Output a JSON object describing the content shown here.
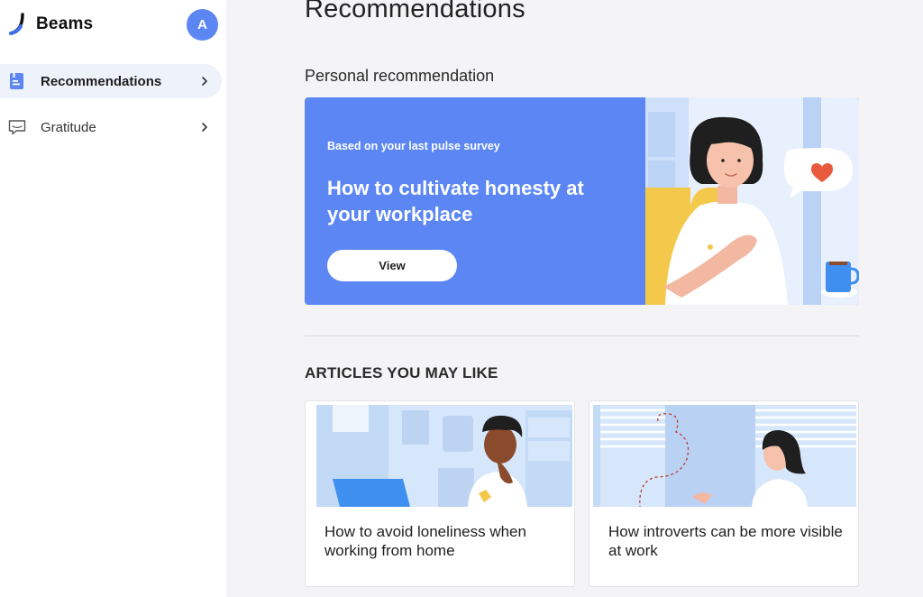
{
  "app": {
    "name": "Beams",
    "avatar_initial": "A",
    "accent": "#5b86f4"
  },
  "sidebar": {
    "items": [
      {
        "label": "Recommendations",
        "icon": "book-icon",
        "active": true
      },
      {
        "label": "Gratitude",
        "icon": "message-icon",
        "active": false
      }
    ]
  },
  "main": {
    "title": "Recommendations",
    "personal": {
      "section_title": "Personal recommendation",
      "kicker": "Based on your last pulse survey",
      "headline": "How to cultivate honesty at your workplace",
      "button_label": "View"
    },
    "articles": {
      "section_title": "ARTICLES YOU MAY LIKE",
      "items": [
        {
          "title": "How to avoid loneliness when working from home"
        },
        {
          "title": "How introverts can be more visible at work"
        }
      ]
    }
  }
}
